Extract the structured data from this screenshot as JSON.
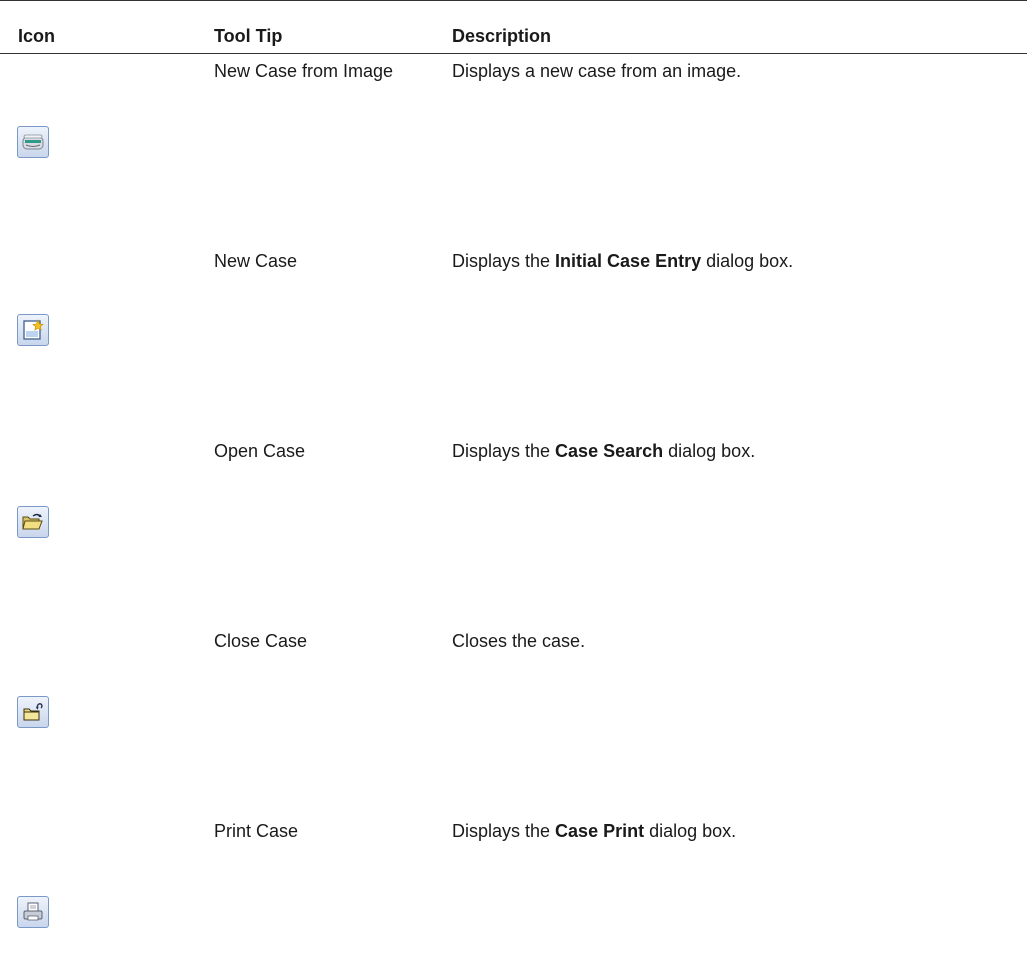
{
  "table": {
    "headers": {
      "icon": "Icon",
      "tooltip": "Tool Tip",
      "description": "Description"
    },
    "rows": [
      {
        "icon": "scanner-icon",
        "tooltip": "New Case from Image",
        "desc_before": "Displays a new case from an image.",
        "desc_bold": "",
        "desc_after": ""
      },
      {
        "icon": "new-document-icon",
        "tooltip": "New Case",
        "desc_before": "Displays the ",
        "desc_bold": "Initial Case Entry",
        "desc_after": " dialog box."
      },
      {
        "icon": "open-folder-icon",
        "tooltip": "Open Case",
        "desc_before": "Displays the ",
        "desc_bold": "Case Search",
        "desc_after": " dialog box."
      },
      {
        "icon": "close-folder-icon",
        "tooltip": "Close Case",
        "desc_before": "Closes the case.",
        "desc_bold": "",
        "desc_after": ""
      },
      {
        "icon": "printer-icon",
        "tooltip": "Print Case",
        "desc_before": "Displays the ",
        "desc_bold": "Case Print",
        "desc_after": " dialog box."
      }
    ]
  }
}
